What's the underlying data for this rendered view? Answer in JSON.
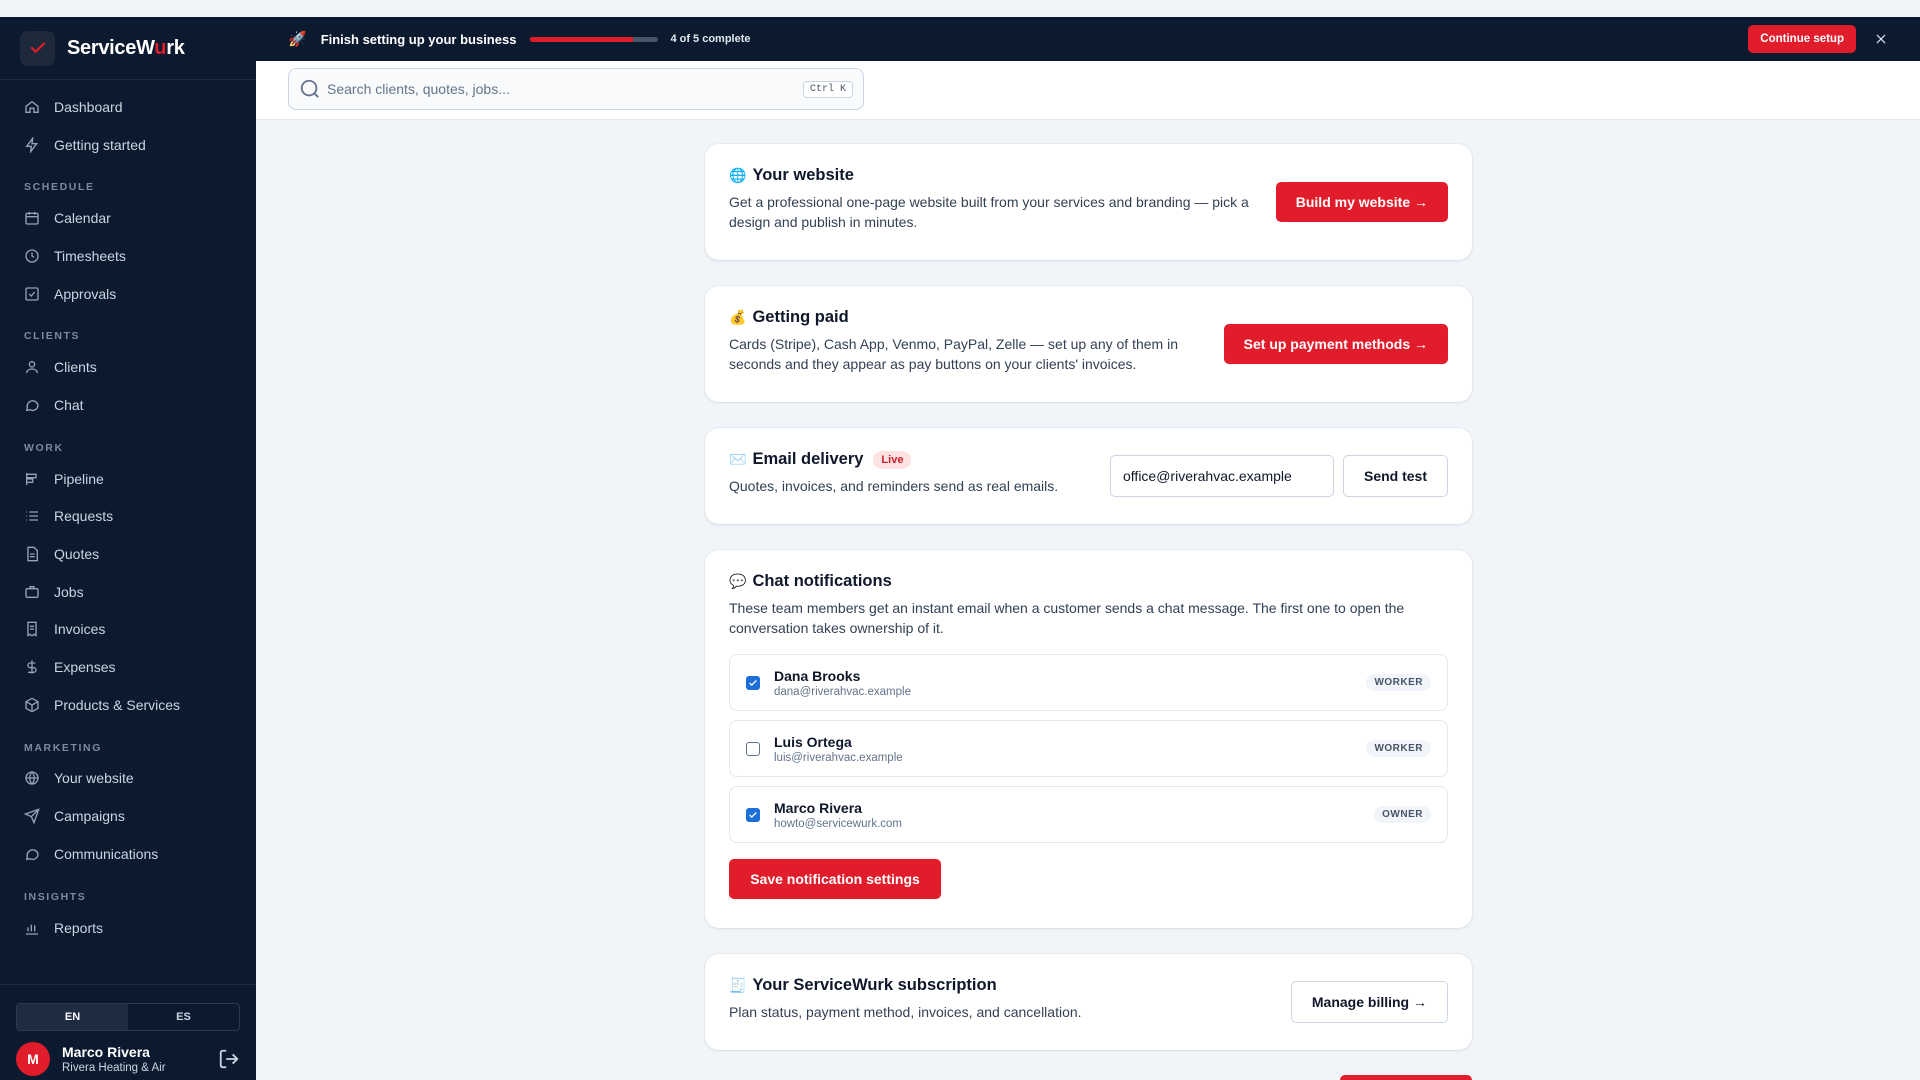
{
  "brand": {
    "name_prefix": "ServiceW",
    "name_accent": "u",
    "name_suffix": "rk",
    "logo_icon": "check-icon"
  },
  "sidebar": {
    "top_items": [
      {
        "label": "Dashboard",
        "icon": "home-icon"
      },
      {
        "label": "Getting started",
        "icon": "bolt-icon"
      }
    ],
    "sections": [
      {
        "title": "SCHEDULE",
        "items": [
          {
            "label": "Calendar",
            "icon": "calendar-icon"
          },
          {
            "label": "Timesheets",
            "icon": "clock-icon"
          },
          {
            "label": "Approvals",
            "icon": "check-square-icon"
          }
        ]
      },
      {
        "title": "CLIENTS",
        "items": [
          {
            "label": "Clients",
            "icon": "user-icon"
          },
          {
            "label": "Chat",
            "icon": "chat-bubble-icon"
          }
        ]
      },
      {
        "title": "WORK",
        "items": [
          {
            "label": "Pipeline",
            "icon": "pipeline-icon"
          },
          {
            "label": "Requests",
            "icon": "list-icon"
          },
          {
            "label": "Quotes",
            "icon": "document-icon"
          },
          {
            "label": "Jobs",
            "icon": "briefcase-icon"
          },
          {
            "label": "Invoices",
            "icon": "invoice-icon"
          },
          {
            "label": "Expenses",
            "icon": "dollar-icon"
          },
          {
            "label": "Products & Services",
            "icon": "box-icon"
          }
        ]
      },
      {
        "title": "MARKETING",
        "items": [
          {
            "label": "Your website",
            "icon": "globe-icon"
          },
          {
            "label": "Campaigns",
            "icon": "send-icon"
          },
          {
            "label": "Communications",
            "icon": "message-icon"
          }
        ]
      },
      {
        "title": "INSIGHTS",
        "items": [
          {
            "label": "Reports",
            "icon": "bar-chart-icon"
          }
        ]
      }
    ],
    "language": {
      "options": [
        "EN",
        "ES"
      ],
      "active": "EN"
    },
    "user": {
      "initial": "M",
      "name": "Marco Rivera",
      "company": "Rivera Heating & Air"
    }
  },
  "setup_banner": {
    "title": "Finish setting up your business",
    "progress": 0.8,
    "count_text": "4 of 5 complete",
    "continue_label": "Continue setup"
  },
  "search": {
    "placeholder": "Search clients, quotes, jobs...",
    "shortcut": "Ctrl K"
  },
  "cards": {
    "website": {
      "emoji": "🌐",
      "title": "Your website",
      "description": "Get a professional one-page website built from your services and branding — pick a design and publish in minutes.",
      "button": "Build my website →"
    },
    "payments": {
      "emoji": "💰",
      "title": "Getting paid",
      "description": "Cards (Stripe), Cash App, Venmo, PayPal, Zelle — set up any of them in seconds and they appear as pay buttons on your clients' invoices.",
      "button": "Set up payment methods →"
    },
    "email": {
      "emoji": "✉️",
      "title": "Email delivery",
      "badge": "Live",
      "description": "Quotes, invoices, and reminders send as real emails.",
      "input_value": "office@riverahvac.example",
      "button": "Send test"
    },
    "chat": {
      "emoji": "💬",
      "title": "Chat notifications",
      "description": "These team members get an instant email when a customer sends a chat message. The first one to open the conversation takes ownership of it.",
      "members": [
        {
          "name": "Dana Brooks",
          "email": "dana@riverahvac.example",
          "role": "WORKER",
          "checked": true
        },
        {
          "name": "Luis Ortega",
          "email": "luis@riverahvac.example",
          "role": "WORKER",
          "checked": false
        },
        {
          "name": "Marco Rivera",
          "email": "howto@servicewurk.com",
          "role": "OWNER",
          "checked": true
        }
      ],
      "save_button": "Save notification settings"
    },
    "subscription": {
      "emoji": "🧾",
      "title": "Your ServiceWurk subscription",
      "description": "Plan status, payment method, invoices, and cancellation.",
      "button": "Manage billing →"
    }
  },
  "colors": {
    "accent": "#e11d2b",
    "sidebar_bg": "#0b1a2e",
    "checkbox": "#1d6fd8"
  }
}
